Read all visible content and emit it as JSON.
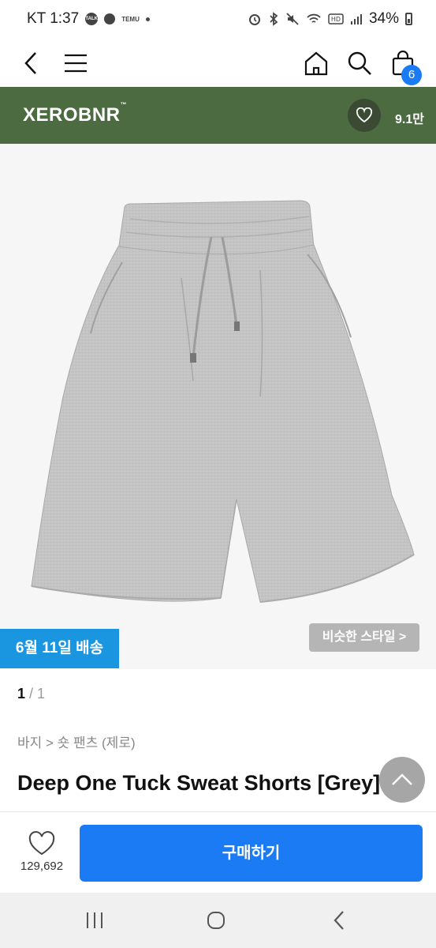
{
  "status_bar": {
    "carrier_time": "KT 1:37",
    "kakao_label": "TALK",
    "temu_label": "TEMU",
    "battery": "34%"
  },
  "nav": {
    "cart_count": "6"
  },
  "brand": {
    "name": "XEROBNR",
    "tm": "™",
    "like_count": "9.1만"
  },
  "product": {
    "delivery": "6월 11일 배송",
    "similar_style": "비슷한 스타일 >",
    "image_index": "1",
    "image_total": " / 1",
    "breadcrumb": "바지 > 숏 팬츠 (제로)",
    "title": "Deep One Tuck Sweat Shorts [Grey]"
  },
  "purchase": {
    "wish_count": "129,692",
    "buy_label": "구매하기"
  },
  "colors": {
    "brand_bar": "#4c6b40",
    "accent": "#1b7bf5",
    "delivery": "#1a96e0"
  }
}
